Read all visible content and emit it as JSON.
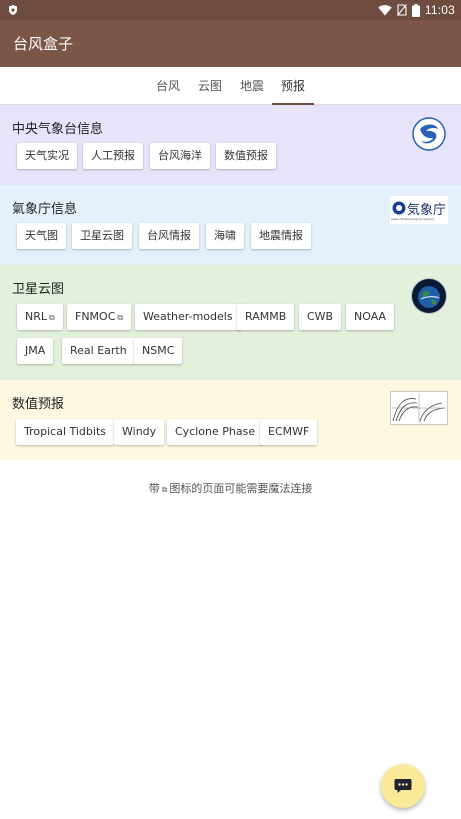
{
  "status_bar": {
    "time": "11:03",
    "icons": [
      "shield-icon",
      "wifi-icon",
      "no-sim-icon",
      "battery-icon"
    ]
  },
  "app_bar": {
    "title": "台风盒子"
  },
  "tabs": [
    {
      "label": "台风",
      "active": false
    },
    {
      "label": "云图",
      "active": false
    },
    {
      "label": "地震",
      "active": false
    },
    {
      "label": "预报",
      "active": true
    }
  ],
  "sections": [
    {
      "title": "中央气象台信息",
      "bg": "#e7e3fb",
      "logo": "cma-logo",
      "chips": [
        {
          "label": "天气实况"
        },
        {
          "label": "人工预报"
        },
        {
          "label": "台风海洋"
        },
        {
          "label": "数值预报"
        }
      ]
    },
    {
      "title": "氣象庁信息",
      "bg": "#e4f0fc",
      "logo": "jma-logo",
      "logo_text": "気象庁",
      "logo_subtext": "Japan Meteorological Agency",
      "chips": [
        {
          "label": "天气图"
        },
        {
          "label": "卫星云图"
        },
        {
          "label": "台风情报"
        },
        {
          "label": "海啸"
        },
        {
          "label": "地震情报"
        }
      ]
    },
    {
      "title": "卫星云图",
      "bg": "#e3f0dc",
      "logo": "satellite-logo",
      "chips": [
        {
          "label": "NRL",
          "external": true
        },
        {
          "label": "FNMOC",
          "external": true
        },
        {
          "label": "Weather-models"
        },
        {
          "label": "RAMMB"
        },
        {
          "label": "CWB"
        },
        {
          "label": "NOAA"
        },
        {
          "label": "JMA"
        },
        {
          "label": "Real Earth"
        },
        {
          "label": "NSMC"
        }
      ]
    },
    {
      "title": "数值预报",
      "bg": "#fdf8e2",
      "logo": "numerical-chart-logo",
      "chips": [
        {
          "label": "Tropical Tidbits"
        },
        {
          "label": "Windy"
        },
        {
          "label": "Cyclone Phase"
        },
        {
          "label": "ECMWF"
        }
      ]
    }
  ],
  "note": {
    "prefix": "带",
    "suffix": "图标的页面可能需要魔法连接",
    "icon": "external-link-icon"
  },
  "fab": {
    "icon": "chat-icon"
  },
  "colors": {
    "status_bar": "#6e4d40",
    "app_bar": "#7a5548",
    "tab_indicator": "#6e4d40",
    "fab": "#fbe99a"
  }
}
